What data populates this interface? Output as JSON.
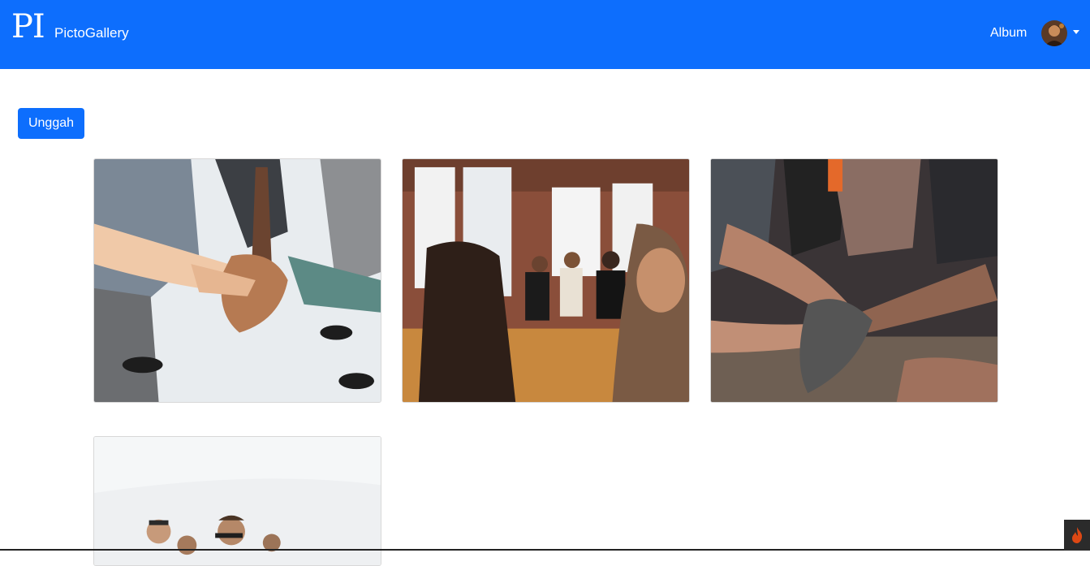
{
  "navbar": {
    "logo_text": "PI",
    "brand_name": "PictoGallery",
    "album_link": "Album",
    "avatar_icon": "user-avatar",
    "dropdown_icon": "caret-down-icon",
    "bg_color": "#0d6efd"
  },
  "main": {
    "upload_label": "Unggah"
  },
  "gallery": {
    "photos": [
      {
        "icon": "team-hands-stack-photo"
      },
      {
        "icon": "meeting-circle-photo"
      },
      {
        "icon": "outdoor-hands-stack-photo"
      },
      {
        "icon": "group-selfie-photo"
      }
    ]
  },
  "debug_toolbar": {
    "icon": "codeigniter-flame-icon"
  }
}
